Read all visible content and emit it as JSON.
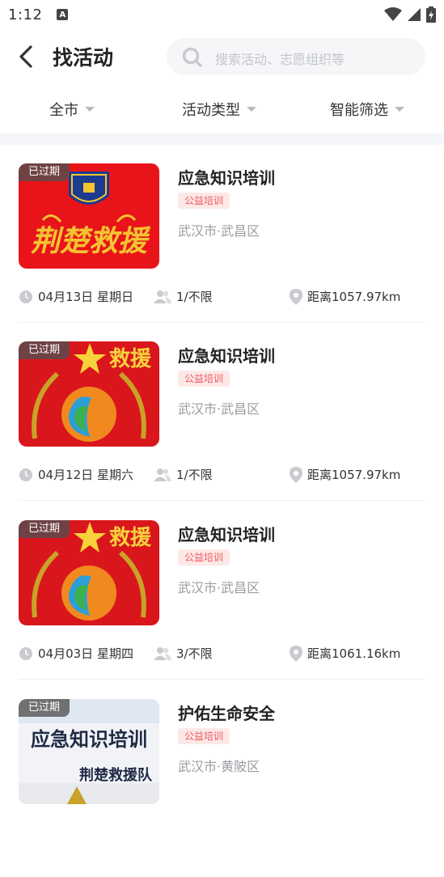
{
  "status_bar": {
    "time": "1:12",
    "notif_letter": "A"
  },
  "header": {
    "title": "找活动",
    "search_placeholder": "搜索活动、志愿组织等"
  },
  "filters": [
    {
      "label": "全市"
    },
    {
      "label": "活动类型"
    },
    {
      "label": "智能筛选"
    }
  ],
  "activities": [
    {
      "status": "已过期",
      "title": "应急知识培训",
      "tag": "公益培训",
      "location": "武汉市·武昌区",
      "date": "04月13日 星期日",
      "participants": "1/不限",
      "distance": "距离1057.97km",
      "image_text": "荆楚救援"
    },
    {
      "status": "已过期",
      "title": "应急知识培训",
      "tag": "公益培训",
      "location": "武汉市·武昌区",
      "date": "04月12日 星期六",
      "participants": "1/不限",
      "distance": "距离1057.97km",
      "image_text": "救援"
    },
    {
      "status": "已过期",
      "title": "应急知识培训",
      "tag": "公益培训",
      "location": "武汉市·武昌区",
      "date": "04月03日 星期四",
      "participants": "3/不限",
      "distance": "距离1061.16km",
      "image_text": "救援"
    },
    {
      "status": "已过期",
      "title": "护佑生命安全",
      "tag": "公益培训",
      "location": "武汉市·黄陂区",
      "image_text": "应急知识培训",
      "image_subtext": "荆楚救援队"
    }
  ],
  "colors": {
    "accent_red": "#ef5a5a",
    "tag_bg": "#fde8e8",
    "muted": "#9a9ca1"
  }
}
